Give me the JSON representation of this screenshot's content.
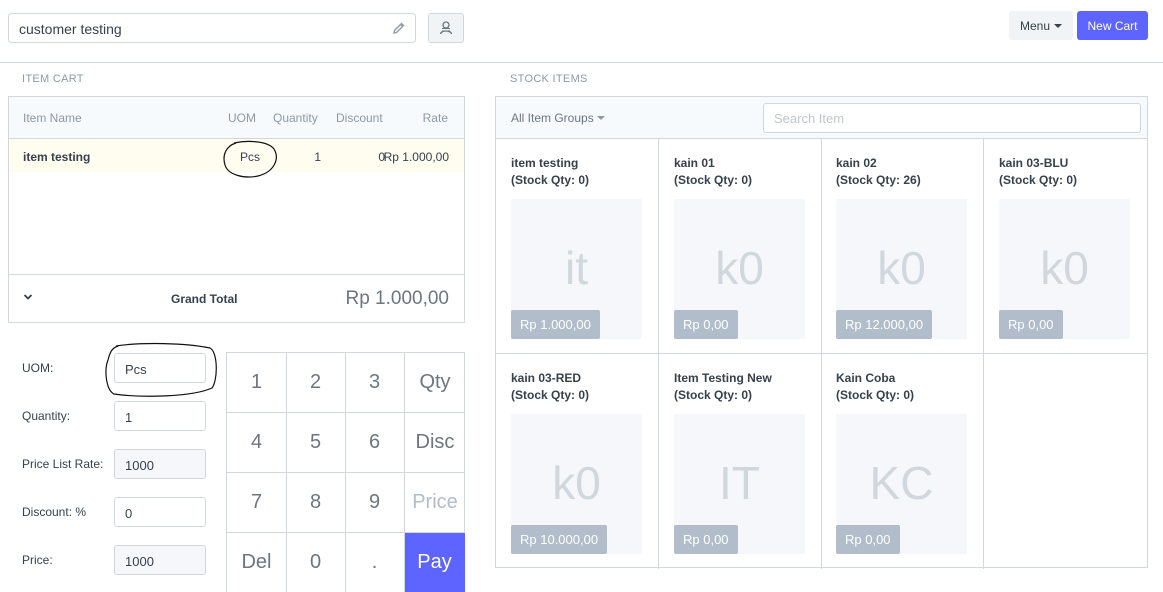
{
  "customer": {
    "value": "customer testing"
  },
  "header": {
    "menu_label": "Menu",
    "new_cart_label": "New Cart"
  },
  "cart": {
    "section_title": "ITEM CART",
    "columns": {
      "item_name": "Item Name",
      "uom": "UOM",
      "quantity": "Quantity",
      "discount": "Discount",
      "rate": "Rate"
    },
    "rows": [
      {
        "item_name": "item testing",
        "uom": "Pcs",
        "quantity": "1",
        "discount": "0",
        "rate": "Rp 1.000,00"
      }
    ],
    "grand_total_label": "Grand Total",
    "grand_total_value": "Rp 1.000,00"
  },
  "fields": {
    "uom": {
      "label": "UOM:",
      "value": "Pcs"
    },
    "quantity": {
      "label": "Quantity:",
      "value": "1"
    },
    "price_list_rate": {
      "label": "Price List Rate:",
      "value": "1000"
    },
    "discount": {
      "label": "Discount: %",
      "value": "0"
    },
    "price": {
      "label": "Price:",
      "value": "1000"
    }
  },
  "numpad": {
    "keys": [
      "1",
      "2",
      "3",
      "Qty",
      "4",
      "5",
      "6",
      "Disc",
      "7",
      "8",
      "9",
      "Price",
      "Del",
      "0",
      ".",
      "Pay"
    ]
  },
  "stock": {
    "section_title": "STOCK ITEMS",
    "group_select": "All Item Groups",
    "search_placeholder": "Search Item",
    "items": [
      {
        "name": "item testing",
        "qty": "(Stock Qty: 0)",
        "abbr": "it",
        "price": "Rp 1.000,00"
      },
      {
        "name": "kain 01",
        "qty": "(Stock Qty: 0)",
        "abbr": "k0",
        "price": "Rp 0,00"
      },
      {
        "name": "kain 02",
        "qty": "(Stock Qty: 26)",
        "abbr": "k0",
        "price": "Rp 12.000,00"
      },
      {
        "name": "kain 03-BLU",
        "qty": "(Stock Qty: 0)",
        "abbr": "k0",
        "price": "Rp 0,00"
      },
      {
        "name": "kain 03-RED",
        "qty": "(Stock Qty: 0)",
        "abbr": "k0",
        "price": "Rp 10.000,00"
      },
      {
        "name": "Item Testing New",
        "qty": "(Stock Qty: 0)",
        "abbr": "IT",
        "price": "Rp 0,00"
      },
      {
        "name": "Kain Coba",
        "qty": "(Stock Qty: 0)",
        "abbr": "KC",
        "price": "Rp 0,00"
      }
    ]
  },
  "colors": {
    "primary": "#5e64ff",
    "border": "#d1d8dd",
    "muted": "#8d99a6"
  }
}
